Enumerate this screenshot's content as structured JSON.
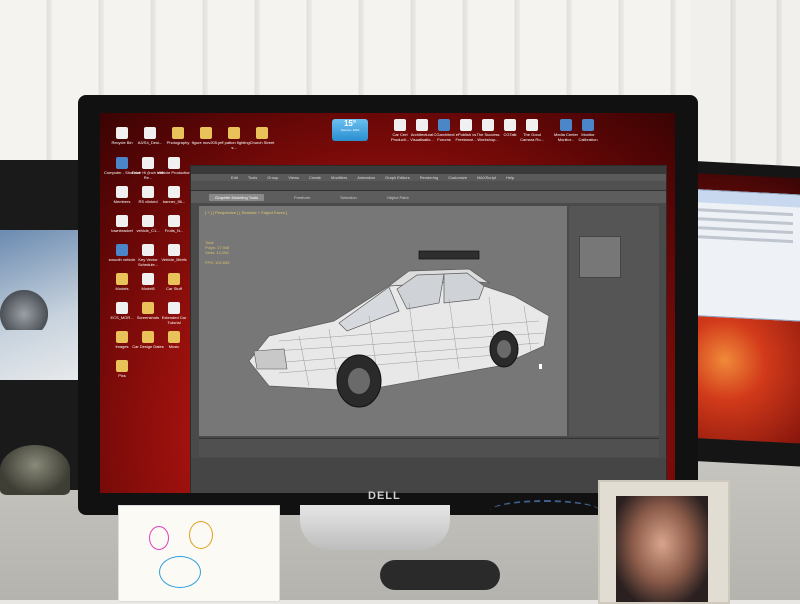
{
  "scene": {
    "monitor_brand": "DELL"
  },
  "desktop": {
    "weather_widget": {
      "temperature": "15°",
      "label": "Taunton, ENG"
    },
    "icons_left": [
      {
        "label": "Recycle Bin",
        "kind": "doc"
      },
      {
        "label": "A3/S4_Desi...",
        "kind": "doc"
      },
      {
        "label": "Photography",
        "kind": "folder"
      },
      {
        "label": "figure mov205...",
        "kind": "folder"
      },
      {
        "label": "jeff patton fighting s...",
        "kind": "folder"
      },
      {
        "label": "Church Street",
        "kind": "folder"
      },
      {
        "label": "Computer - Shortcut",
        "kind": "app"
      },
      {
        "label": "Drive Hl (inch with Re...",
        "kind": "doc"
      },
      {
        "label": "Vehicle Production",
        "kind": "doc"
      },
      {
        "label": "Members",
        "kind": "doc"
      },
      {
        "label": "RS clinked",
        "kind": "doc"
      },
      {
        "label": "banner_96...",
        "kind": "doc"
      },
      {
        "label": "townbracket",
        "kind": "doc"
      },
      {
        "label": "vehicle_C1...",
        "kind": "doc"
      },
      {
        "label": "Fruits_N...",
        "kind": "doc"
      },
      {
        "label": "smooth vehicle",
        "kind": "app"
      },
      {
        "label": "Key Vector Schedule...",
        "kind": "doc"
      },
      {
        "label": "Vehicle_Briefs",
        "kind": "doc"
      },
      {
        "label": "Models",
        "kind": "folder"
      },
      {
        "label": "Model8",
        "kind": "doc"
      },
      {
        "label": "Car Stuff",
        "kind": "folder"
      },
      {
        "label": "ECS_MOR...",
        "kind": "doc"
      },
      {
        "label": "Screenshots",
        "kind": "folder"
      },
      {
        "label": "Extended Car Tutorial",
        "kind": "doc"
      },
      {
        "label": "Images",
        "kind": "folder"
      },
      {
        "label": "Car Design Dates",
        "kind": "folder"
      },
      {
        "label": "Music",
        "kind": "folder"
      },
      {
        "label": "Pics",
        "kind": "folder"
      }
    ],
    "icons_top": [
      {
        "label": "Car Cert Producti...",
        "kind": "doc"
      },
      {
        "label": "Architectural Visualisatio...",
        "kind": "doc"
      },
      {
        "label": "CGarchitect Forums",
        "kind": "app"
      },
      {
        "label": "ePublish vs Freelance...",
        "kind": "doc"
      },
      {
        "label": "The Success Workshop...",
        "kind": "doc"
      },
      {
        "label": "CGTalk",
        "kind": "doc"
      },
      {
        "label": "The Good Camara Ro...",
        "kind": "doc"
      },
      {
        "label": "Media Center Monitor...",
        "kind": "app"
      },
      {
        "label": "Monitor Calibration",
        "kind": "app"
      }
    ]
  },
  "app": {
    "menus": [
      "Edit",
      "Tools",
      "Group",
      "Views",
      "Create",
      "Modifiers",
      "Animation",
      "Graph Editors",
      "Rendering",
      "Customize",
      "MAXScript",
      "Help"
    ],
    "ribbon_tabs": [
      "Graphite Modeling Tools",
      "Freeform",
      "Selection",
      "Object Paint"
    ],
    "active_ribbon_tab": "Graphite Modeling Tools",
    "viewport_label": "[ + ] [ Perspective ] [ Realistic + Edged Faces ]",
    "stats": [
      "Total",
      "Polys: 17,946",
      "Verts: 12,256",
      "",
      "FPS: 102.835"
    ]
  }
}
